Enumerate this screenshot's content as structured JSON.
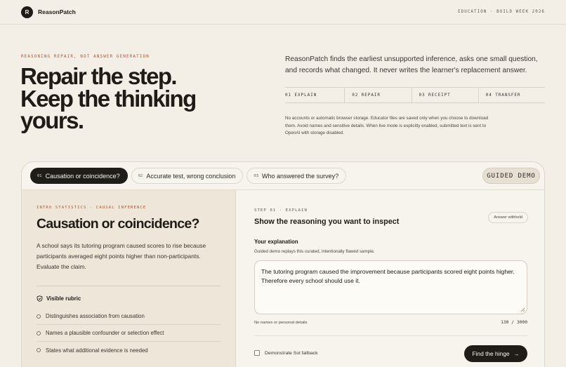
{
  "header": {
    "logo_letter": "R",
    "brand": "ReasonPatch",
    "meta": "EDUCATION · BUILD WEEK 2026"
  },
  "hero": {
    "kicker": "REASONING REPAIR, NOT ANSWER GENERATION",
    "headline_lines": [
      "Repair the step.",
      "Keep the thinking",
      "yours."
    ],
    "lede": "ReasonPatch finds the earliest unsupported inference, asks one small question, and records what changed. It never writes the learner's replacement answer.",
    "steps": [
      "01 EXPLAIN",
      "02 REPAIR",
      "03 RECEIPT",
      "04 TRANSFER"
    ],
    "privacy": "No accounts or automatic browser storage. Educator files are saved only when you choose to download them. Avoid names and sensitive details. When live mode is explicitly enabled, submitted text is sent to OpenAI with storage disabled."
  },
  "demo": {
    "tabs": [
      {
        "num": "01",
        "label": "Causation or coincidence?"
      },
      {
        "num": "02",
        "label": "Accurate test, wrong conclusion"
      },
      {
        "num": "03",
        "label": "Who answered the survey?"
      }
    ],
    "mode_badge": "GUIDED DEMO",
    "problem": {
      "kicker": "INTRO STATISTICS · CAUSAL INFERENCE",
      "title": "Causation or coincidence?",
      "body": "A school says its tutoring program caused scores to rise because participants averaged eight points higher than non-participants. Evaluate the claim.",
      "rubric_title": "Visible rubric",
      "rubric_items": [
        "Distinguishes association from causation",
        "Names a plausible confounder or selection effect",
        "States what additional evidence is needed"
      ]
    },
    "explain": {
      "kicker": "STEP 01 · EXPLAIN",
      "title": "Show the reasoning you want to inspect",
      "withheld_badge": "Answer withheld",
      "field_label": "Your explanation",
      "field_hint": "Guided demo replays this curated, intentionally flawed sample.",
      "explanation": "The tutoring program caused the improvement because participants scored eight points higher. Therefore every school should use it.",
      "privacy_note": "No names or personal details",
      "char_count": "130 / 3000",
      "fallback_label": "Demonstrate Sol fallback",
      "fallback_checked": false,
      "cta_label": "Find the hinge",
      "cta_arrow": "→"
    }
  },
  "colors": {
    "background": "#f3efe7",
    "accent": "#b0542a",
    "ink": "#1f1c18",
    "panel_left": "#efe6da"
  }
}
